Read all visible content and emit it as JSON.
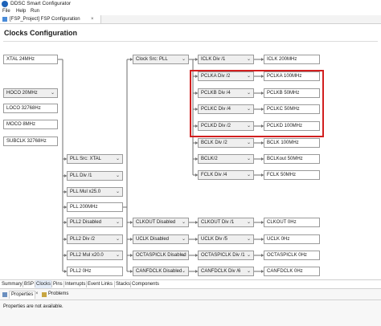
{
  "window": {
    "title": "DDSC Smart Configurator"
  },
  "menu": [
    "File",
    "Help",
    "Run"
  ],
  "editor_tab": {
    "label": "[FSP_Project] FSP Configuration",
    "close": "×"
  },
  "page_title": "Clocks Configuration",
  "nodes": [
    {
      "id": "xtal",
      "text": "XTAL 24MHz",
      "dropdown": false
    },
    {
      "id": "hoco",
      "text": "HOCO 20MHz",
      "dropdown": true
    },
    {
      "id": "loco",
      "text": "LOCO 32768Hz",
      "dropdown": false
    },
    {
      "id": "moco",
      "text": "MOCO 8MHz",
      "dropdown": false
    },
    {
      "id": "subclk",
      "text": "SUBCLK 32768Hz",
      "dropdown": false
    },
    {
      "id": "pll_src",
      "text": "PLL Src: XTAL",
      "dropdown": true
    },
    {
      "id": "pll_div",
      "text": "PLL Div /1",
      "dropdown": true
    },
    {
      "id": "pll_mul",
      "text": "PLL Mul x25.0",
      "dropdown": true
    },
    {
      "id": "pll_out",
      "text": "PLL 200MHz",
      "dropdown": false
    },
    {
      "id": "pll2_src",
      "text": "PLL2 Disabled",
      "dropdown": true
    },
    {
      "id": "pll2_div",
      "text": "PLL2 Div /2",
      "dropdown": true
    },
    {
      "id": "pll2_mul",
      "text": "PLL2 Mul x20.0",
      "dropdown": true
    },
    {
      "id": "pll2_out",
      "text": "PLL2 0Hz",
      "dropdown": false
    },
    {
      "id": "clk_src",
      "text": "Clock Src: PLL",
      "dropdown": true
    },
    {
      "id": "iclk_div",
      "text": "ICLK Div /1",
      "dropdown": true
    },
    {
      "id": "iclk_out",
      "text": "ICLK 200MHz",
      "dropdown": false
    },
    {
      "id": "pclka_div",
      "text": "PCLKA Div /2",
      "dropdown": true
    },
    {
      "id": "pclka_out",
      "text": "PCLKA 100MHz",
      "dropdown": false
    },
    {
      "id": "pclkb_div",
      "text": "PCLKB Div /4",
      "dropdown": true
    },
    {
      "id": "pclkb_out",
      "text": "PCLKB 50MHz",
      "dropdown": false
    },
    {
      "id": "pclkc_div",
      "text": "PCLKC Div /4",
      "dropdown": true
    },
    {
      "id": "pclkc_out",
      "text": "PCLKC 50MHz",
      "dropdown": false
    },
    {
      "id": "pclkd_div",
      "text": "PCLKD Div /2",
      "dropdown": true
    },
    {
      "id": "pclkd_out",
      "text": "PCLKD 100MHz",
      "dropdown": false
    },
    {
      "id": "bclk_div",
      "text": "BCLK Div /2",
      "dropdown": true
    },
    {
      "id": "bclk_out",
      "text": "BCLK 100MHz",
      "dropdown": false
    },
    {
      "id": "bclkout_div",
      "text": "BCLK/2",
      "dropdown": true
    },
    {
      "id": "bclkout_out",
      "text": "BCLKout 50MHz",
      "dropdown": false
    },
    {
      "id": "fclk_div",
      "text": "FCLK Div /4",
      "dropdown": true
    },
    {
      "id": "fclk_out",
      "text": "FCLK 50MHz",
      "dropdown": false
    },
    {
      "id": "clkout_src",
      "text": "CLKOUT Disabled",
      "dropdown": true
    },
    {
      "id": "clkout_div",
      "text": "CLKOUT Div /1",
      "dropdown": true
    },
    {
      "id": "clkout_out",
      "text": "CLKOUT 0Hz",
      "dropdown": false
    },
    {
      "id": "uclk_src",
      "text": "UCLK Disabled",
      "dropdown": true
    },
    {
      "id": "uclk_div",
      "text": "UCLK Div /5",
      "dropdown": true
    },
    {
      "id": "uclk_out",
      "text": "UCLK 0Hz",
      "dropdown": false
    },
    {
      "id": "octa_src",
      "text": "OCTASPICLK Disabled",
      "dropdown": true
    },
    {
      "id": "octa_div",
      "text": "OCTASPICLK Div /1",
      "dropdown": true
    },
    {
      "id": "octa_out",
      "text": "OCTASPICLK 0Hz",
      "dropdown": false
    },
    {
      "id": "canfd_src",
      "text": "CANFDCLK Disabled",
      "dropdown": true
    },
    {
      "id": "canfd_div",
      "text": "CANFDCLK Div /6",
      "dropdown": true
    },
    {
      "id": "canfd_out",
      "text": "CANFDCLK 0Hz",
      "dropdown": false
    }
  ],
  "chevron": "⌄",
  "config_tabs": [
    {
      "label": "Summary",
      "active": false
    },
    {
      "label": "BSP",
      "active": false
    },
    {
      "label": "Clocks",
      "active": true
    },
    {
      "label": "Pins",
      "active": false
    },
    {
      "label": "Interrupts",
      "active": false
    },
    {
      "label": "Event Links",
      "active": false
    },
    {
      "label": "Stacks",
      "active": false
    },
    {
      "label": "Components",
      "active": false
    }
  ],
  "views": {
    "properties_tab": "Properties",
    "problems_tab": "Problems",
    "close": "×",
    "message": "Properties are not available."
  },
  "colors": {
    "highlight": "#d21f1f",
    "accent": "#1e63b8"
  }
}
